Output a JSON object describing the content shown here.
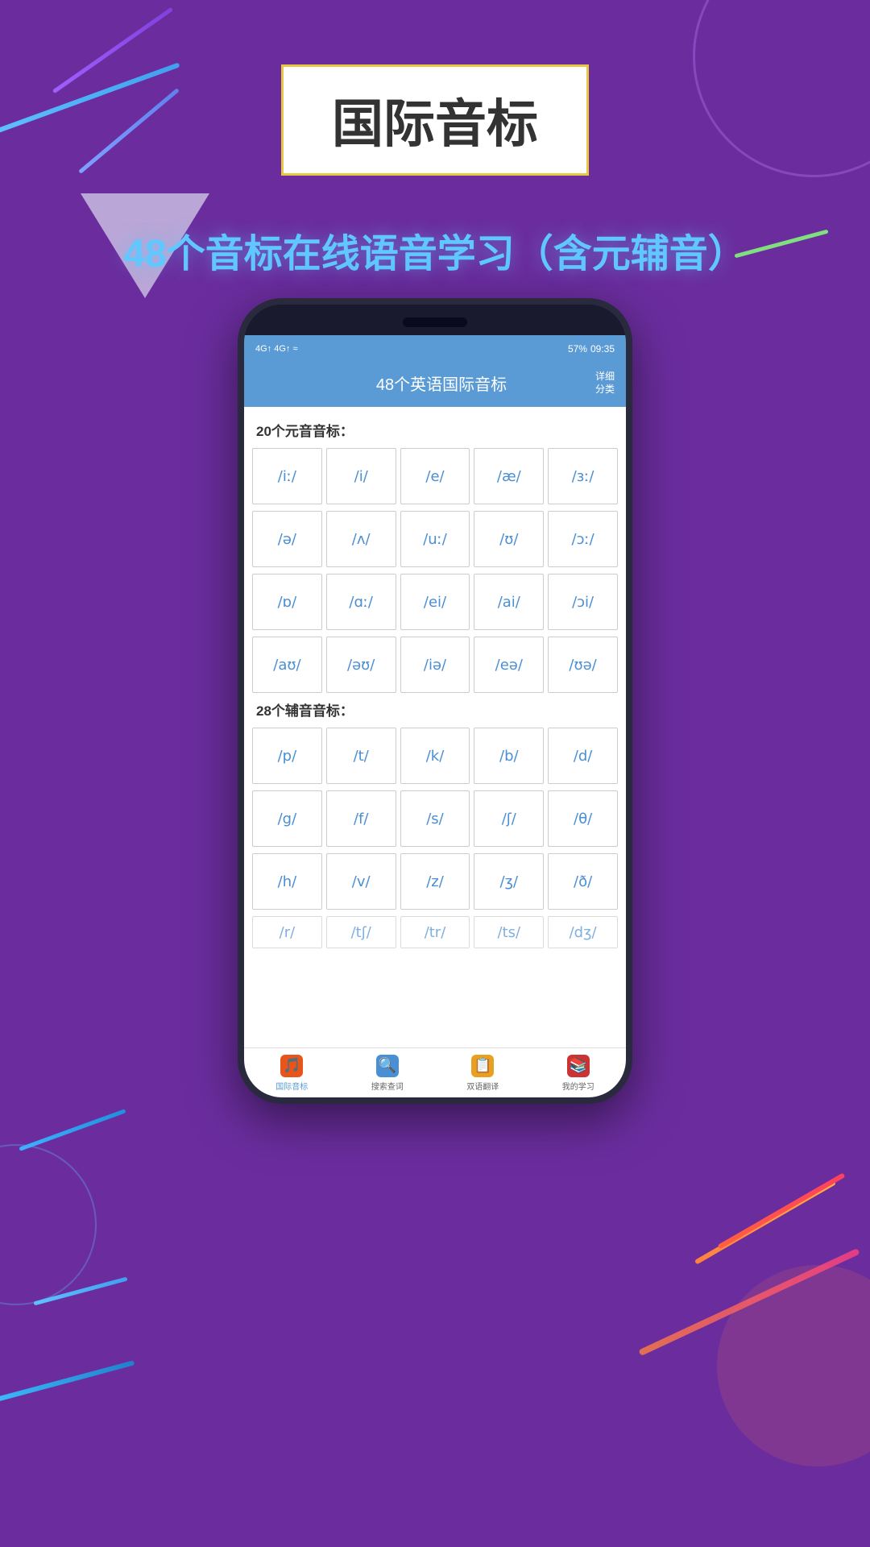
{
  "page": {
    "bg_color": "#6b2d9e",
    "title_box": "国际音标",
    "subtitle": "48个音标在线语音学习（含元辅音）"
  },
  "status_bar": {
    "left": "4G↑ 4G↑ WiFi",
    "battery": "57%",
    "time": "09:35"
  },
  "app_header": {
    "title": "48个英语国际音标",
    "detail_label": "详细\n分类"
  },
  "vowels": {
    "section_title": "20个元音音标：",
    "row1": [
      "/iː/",
      "/i/",
      "/e/",
      "/æ/",
      "/ɜː/"
    ],
    "row2": [
      "/ə/",
      "/ʌ/",
      "/uː/",
      "/ʊ/",
      "/ɔː/"
    ],
    "row3": [
      "/ɒ/",
      "/ɑː/",
      "/ei/",
      "/ai/",
      "/ɔi/"
    ],
    "row4": [
      "/aʊ/",
      "/əʊ/",
      "/iə/",
      "/eə/",
      "/ʊə/"
    ]
  },
  "consonants": {
    "section_title": "28个辅音音标：",
    "row1": [
      "/p/",
      "/t/",
      "/k/",
      "/b/",
      "/d/"
    ],
    "row2": [
      "/g/",
      "/f/",
      "/s/",
      "/ʃ/",
      "/θ/"
    ],
    "row3": [
      "/h/",
      "/v/",
      "/z/",
      "/ʒ/",
      "/ð/"
    ],
    "row4": [
      "/r/",
      "/tʃ/",
      "/tr/",
      "/ts/",
      "/dʒ/"
    ]
  },
  "bottom_nav": {
    "items": [
      {
        "label": "国际音标",
        "active": true,
        "icon": "🎵"
      },
      {
        "label": "搜索查词",
        "active": false,
        "icon": "🔍"
      },
      {
        "label": "双语翻译",
        "active": false,
        "icon": "📋"
      },
      {
        "label": "我的学习",
        "active": false,
        "icon": "📚"
      }
    ]
  }
}
